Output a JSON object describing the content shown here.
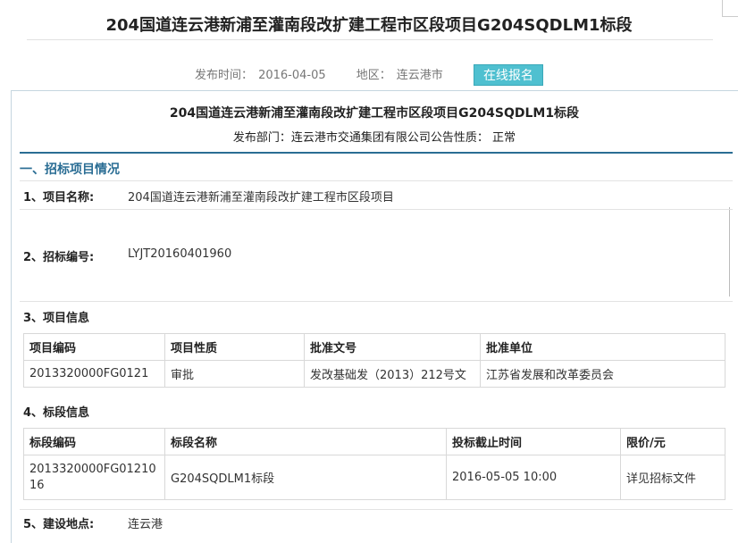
{
  "page": {
    "title": "204国道连云港新浦至灌南段改扩建工程市区段项目G204SQDLM1标段",
    "publish_label": "发布时间：",
    "publish_date": "2016-04-05",
    "region_label": "地区：",
    "region": "连云港市",
    "signup_button": "在线报名"
  },
  "doc": {
    "title": "204国道连云港新浦至灌南段改扩建工程市区段项目G204SQDLM1标段",
    "dept_line": "发布部门：连云港市交通集团有限公司公告性质：  正常",
    "section1": "一、招标项目情况",
    "item1_label": "1、项目名称:",
    "item1_value": "204国道连云港新浦至灌南段改扩建工程市区段项目",
    "item2_label": "2、招标编号:",
    "item2_value": "LYJT20160401960",
    "item3_label": "3、项目信息",
    "project_table": {
      "headers": [
        "项目编码",
        "项目性质",
        "批准文号",
        "批准单位"
      ],
      "row": [
        "2013320000FG0121",
        "审批",
        "发改基础发（2013）212号文",
        "江苏省发展和改革委员会"
      ]
    },
    "item4_label": "4、标段信息",
    "lot_table": {
      "headers": [
        "标段编码",
        "标段名称",
        "投标截止时间",
        "限价/元"
      ],
      "row": [
        "2013320000FG0121016",
        "G204SQDLM1标段",
        "2016-05-05 10:00",
        "详见招标文件"
      ]
    },
    "item5_label": "5、建设地点:",
    "item5_value": "连云港"
  },
  "colors": {
    "accent": "#2a6d94",
    "button": "#4fc0d0"
  }
}
